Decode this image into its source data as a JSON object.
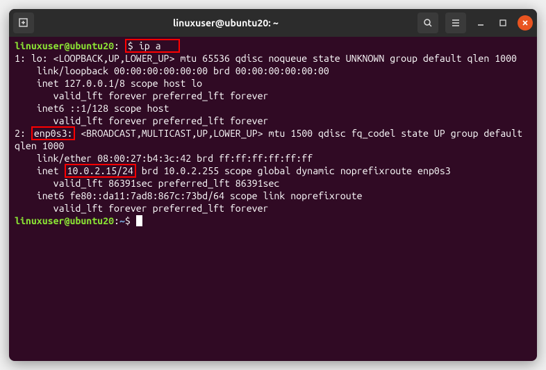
{
  "titlebar": {
    "title": "linuxuser@ubuntu20: ~"
  },
  "prompt": {
    "user_host": "linuxuser@ubuntu20",
    "colon": ":",
    "path": "~",
    "dollar": "$"
  },
  "command": "ip a",
  "output": {
    "line1": "1: lo: <LOOPBACK,UP,LOWER_UP> mtu 65536 qdisc noqueue state UNKNOWN group default qlen 1000",
    "line2": "    link/loopback 00:00:00:00:00:00 brd 00:00:00:00:00:00",
    "line3": "    inet 127.0.0.1/8 scope host lo",
    "line4": "       valid_lft forever preferred_lft forever",
    "line5": "    inet6 ::1/128 scope host ",
    "line6": "       valid_lft forever preferred_lft forever",
    "iface2_prefix": "2: ",
    "iface2_name": "enp0s3:",
    "iface2_rest": " <BROADCAST,MULTICAST,UP,LOWER_UP> mtu 1500 qdisc fq_codel state UP group default qlen 1000",
    "line8": "    link/ether 08:00:27:b4:3c:42 brd ff:ff:ff:ff:ff:ff",
    "inet_prefix": "    inet ",
    "inet_ip": "10.0.2.15/24",
    "inet_rest": " brd 10.0.2.255 scope global dynamic noprefixroute enp0s3",
    "line10": "       valid_lft 86391sec preferred_lft 86391sec",
    "line11": "    inet6 fe80::da11:7ad8:867c:73bd/64 scope link noprefixroute ",
    "line12": "       valid_lft forever preferred_lft forever"
  },
  "highlights": {
    "command": true,
    "interface": true,
    "ip": true
  }
}
